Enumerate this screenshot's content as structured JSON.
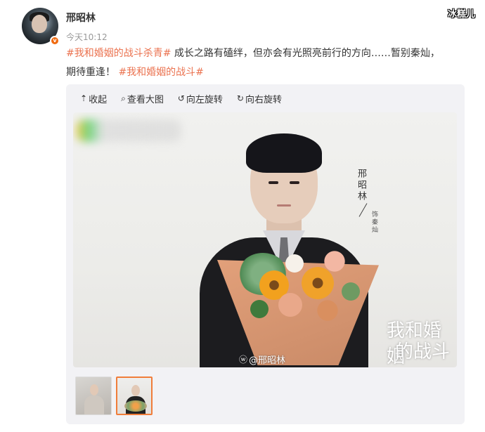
{
  "post": {
    "username": "邢昭林",
    "timestamp": "今天10:12",
    "verified_badge": "v",
    "corner_watermark": "冰糕儿",
    "content": {
      "tag1": "#我和婚姻的战斗杀青#",
      "text1": " 成长之路有磕绊，但亦会有光照亮前行的方向……暂别秦灿，",
      "text2": "期待重逢！ ",
      "tag2": "#我和婚姻的战斗#"
    }
  },
  "media": {
    "toolbar": [
      {
        "icon": "collapse-icon",
        "glyph": "⇡",
        "label": "收起"
      },
      {
        "icon": "zoom-icon",
        "glyph": "⌕",
        "label": "查看大图"
      },
      {
        "icon": "rotate-left-icon",
        "glyph": "↺",
        "label": "向左旋转"
      },
      {
        "icon": "rotate-right-icon",
        "glyph": "↻",
        "label": "向右旋转"
      }
    ],
    "photo": {
      "vertical_name": "邢昭林",
      "vertical_role": "饰秦灿",
      "title_line1": "我和婚姻",
      "title_line2": "的战斗",
      "credit": "@邢昭林"
    },
    "thumbnails_selected_index": 1
  },
  "colors": {
    "tag": "#eb7350",
    "badge": "#f06a10",
    "selected_thumb_border": "#f07d3a"
  }
}
